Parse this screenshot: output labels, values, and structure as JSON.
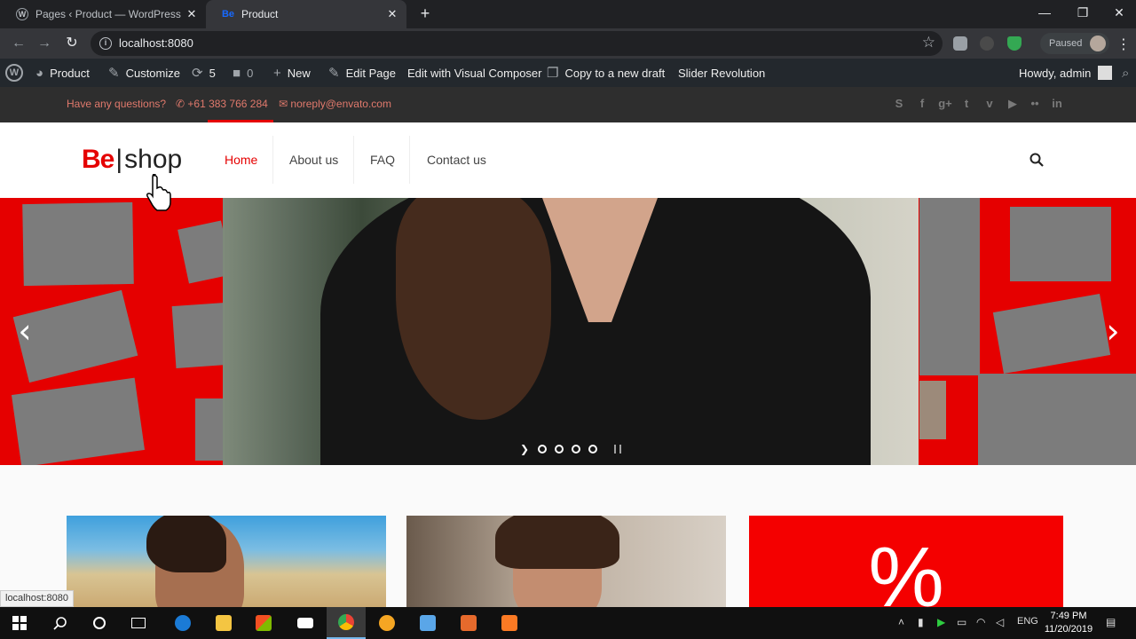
{
  "browser": {
    "tabs": [
      {
        "title": "Pages ‹ Product — WordPress",
        "active": false
      },
      {
        "title": "Product",
        "active": true
      }
    ],
    "url": "localhost:8080",
    "profile_label": "Paused",
    "status_url": "localhost:8080"
  },
  "adminbar": {
    "site": "Product",
    "customize": "Customize",
    "updates": "5",
    "comments": "0",
    "new": "New",
    "edit_page": "Edit Page",
    "visual_composer": "Edit with Visual Composer",
    "copy_draft": "Copy to a new draft",
    "slider_revolution": "Slider Revolution",
    "howdy": "Howdy, admin"
  },
  "infobar": {
    "question": "Have any questions?",
    "phone": "+61 383 766 284",
    "email": "noreply@envato.com",
    "social_icons": [
      "skype-icon",
      "facebook-icon",
      "google-plus-icon",
      "twitter-icon",
      "vimeo-icon",
      "youtube-icon",
      "flickr-icon",
      "linkedin-icon"
    ]
  },
  "header": {
    "logo_be": "Be",
    "logo_shop": "shop",
    "menu": [
      {
        "label": "Home",
        "active": true
      },
      {
        "label": "About us",
        "active": false
      },
      {
        "label": "FAQ",
        "active": false
      },
      {
        "label": "Contact us",
        "active": false
      }
    ]
  },
  "slider": {
    "bullet_count": 4,
    "prev_glyph": "‹",
    "next_glyph": "›"
  },
  "cards": {
    "sale_symbol": "%"
  },
  "taskbar": {
    "language": "ENG",
    "time": "7:49 PM",
    "date": "11/20/2019"
  },
  "colors": {
    "accent": "#e50000",
    "adminbar": "#23282d",
    "infobar": "#2e2e2e",
    "chrome_dark": "#202124"
  }
}
